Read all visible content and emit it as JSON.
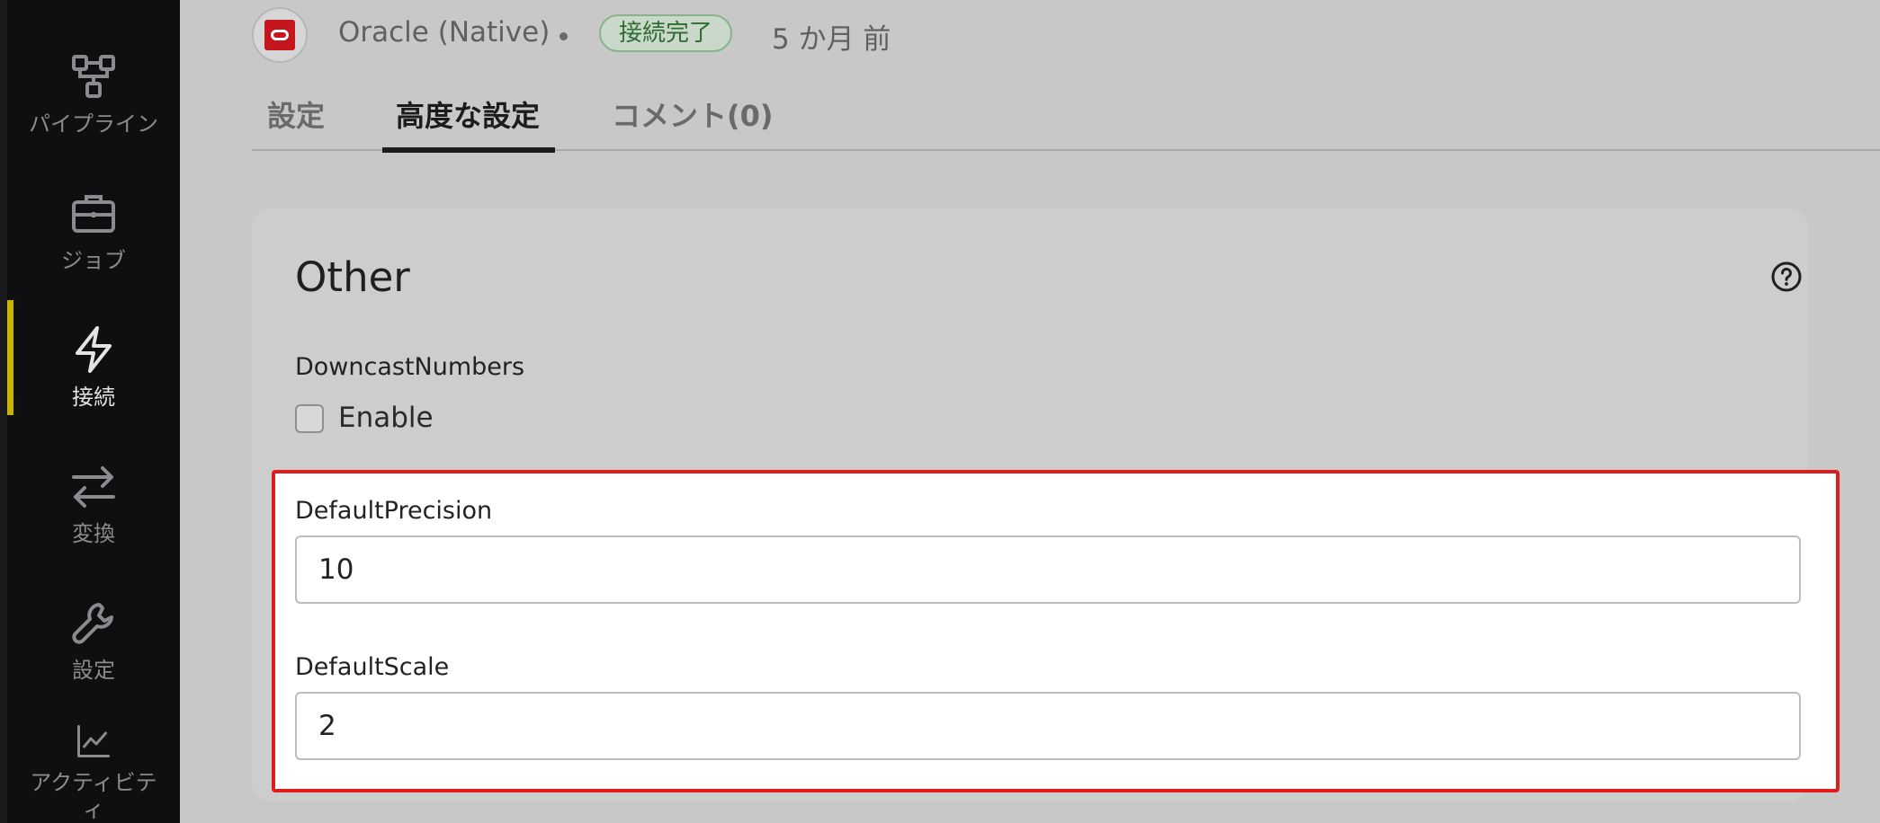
{
  "sidebar": {
    "items": [
      {
        "label": "パイプライン",
        "icon": "pipeline-icon",
        "active": false
      },
      {
        "label": "ジョブ",
        "icon": "briefcase-icon",
        "active": false
      },
      {
        "label": "接続",
        "icon": "lightning-icon",
        "active": true
      },
      {
        "label": "変換",
        "icon": "swap-arrows-icon",
        "active": false
      },
      {
        "label": "設定",
        "icon": "wrench-icon",
        "active": false
      },
      {
        "label": "アクティビティ",
        "icon": "chart-line-icon",
        "active": false
      }
    ]
  },
  "header": {
    "connection_name": "Oracle (Native)",
    "status": "接続完了",
    "time_ago": "5 か月 前"
  },
  "tabs": [
    {
      "label": "設定",
      "active": false
    },
    {
      "label": "高度な設定",
      "active": true
    },
    {
      "label": "コメント(0)",
      "active": false
    }
  ],
  "section": {
    "title": "Other",
    "downcast": {
      "label": "DowncastNumbers",
      "checkbox_label": "Enable",
      "checked": false
    },
    "default_precision": {
      "label": "DefaultPrecision",
      "value": "10"
    },
    "default_scale": {
      "label": "DefaultScale",
      "value": "2"
    }
  },
  "colors": {
    "accent": "#c8b400",
    "highlight_border": "#e21b1b",
    "status_green": "#2d6b30",
    "oracle_red": "#c4161c"
  }
}
